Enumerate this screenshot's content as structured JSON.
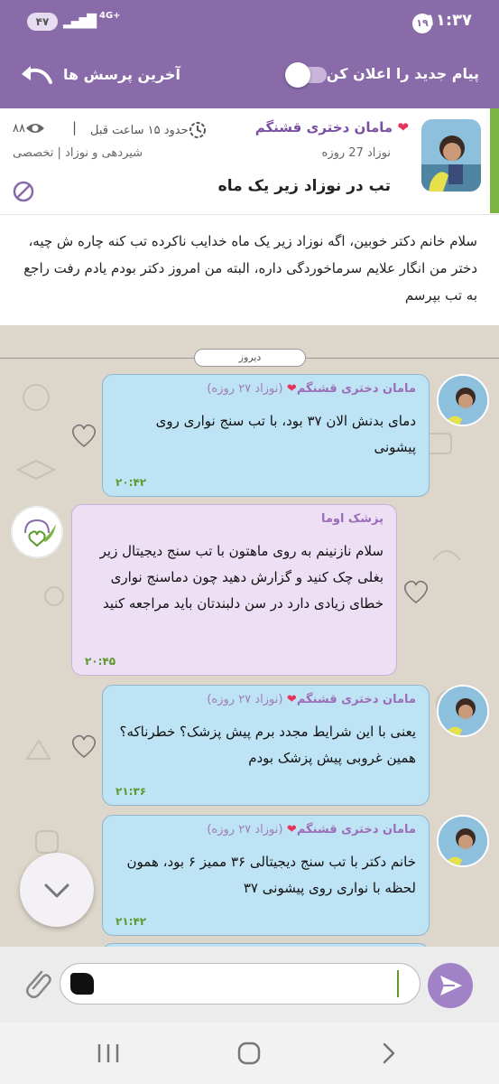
{
  "status_bar": {
    "time": "۱۱:۳۷",
    "notification_count": "۱۹",
    "battery": "۴۷",
    "network": "4G+"
  },
  "toolbar": {
    "notify_label": "پیام جدید را اعلان کن",
    "recent_label": "آخرین پرسش ها",
    "notify_enabled": false
  },
  "question": {
    "author": "مامان دختری قشنگم",
    "time_ago": "حدود ۱۵ ساعت قبل",
    "views": "۸۸",
    "age": "نوزاد 27 روزه",
    "category": "شیردهی و نوزاد | تخصصی",
    "title": "تب در نوزاد زیر یک ماه",
    "body": "سلام خانم دکتر خوبین، اگه نوزاد زیر یک ماه خدایب ناکرده تب کنه چاره ش چیه، دختر من انگار علایم سرماخوردگی داره، البته من امروز دکتر بودم یادم رفت راجع به تب بپرسم"
  },
  "chat": {
    "date_label": "دیروز",
    "messages": [
      {
        "sender": "مامان دختری قشنگم",
        "meta": "(نوزاد ۲۷ روزه)",
        "text": "دمای بدنش الان ۳۷ بود، با تب سنج نواری روی پیشونی",
        "time": "۲۰:۴۲"
      },
      {
        "sender": "پزشک اوما",
        "meta": "",
        "text": "سلام نازنینم به روی ماهتون با تب سنج دیجیتال زیر بغلی چک کنید و گزارش دهید چون دماسنج نواری خطای زیادی دارد در سن دلبندتان باید مراجعه کنید",
        "time": "۲۰:۴۵"
      },
      {
        "sender": "مامان دختری قشنگم",
        "meta": "(نوزاد ۲۷ روزه)",
        "text": "یعنی با این شرایط مجدد برم پیش پزشک؟ خطرناکه؟ همین غروبی پیش پزشک بودم",
        "time": "۲۱:۳۶"
      },
      {
        "sender": "مامان دختری قشنگم",
        "meta": "(نوزاد ۲۷ روزه)",
        "text": "خانم دکتر با تب سنج دیجیتالی ۳۶ ممیز ۶ بود، همون لحظه با نواری روی پیشونی ۳۷",
        "time": "۲۱:۴۲"
      }
    ]
  },
  "composer": {
    "message_value": ""
  },
  "colors": {
    "primary": "#8a6ba9",
    "accent_green": "#7cb342",
    "user_bubble": "#bde3f5",
    "doctor_bubble": "#eddff4",
    "send_button": "#a182c6"
  }
}
